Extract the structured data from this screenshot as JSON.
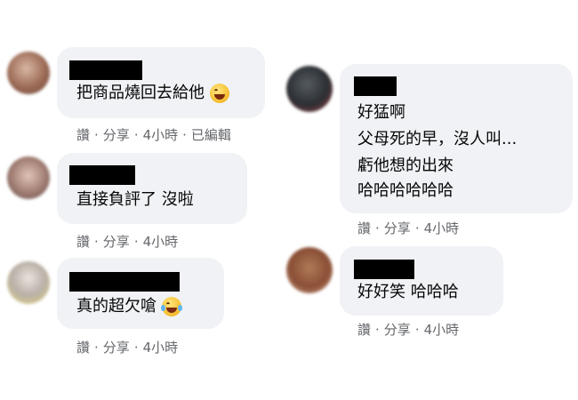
{
  "comments": [
    {
      "text_lines": [
        "把商品燒回去給他"
      ],
      "emoji": "grinning-squinting-tongue-emoji",
      "actions": {
        "reply": "讚",
        "share": "分享",
        "time": "4小時",
        "edited": "已編輯"
      }
    },
    {
      "text_lines": [
        "直接負評了 沒啦"
      ],
      "actions": {
        "reply": "讚",
        "share": "分享",
        "time": "4小時"
      }
    },
    {
      "text_lines": [
        "真的超欠嗆"
      ],
      "emoji": "face-with-tears-of-joy-emoji",
      "actions": {
        "reply": "讚",
        "share": "分享",
        "time": "4小時"
      }
    },
    {
      "text_lines": [
        "好猛啊",
        "父母死的早，沒人叫...",
        "虧他想的出來",
        "哈哈哈哈哈哈"
      ],
      "actions": {
        "reply": "讚",
        "share": "分享",
        "time": "4小時"
      }
    },
    {
      "text_lines": [
        "好好笑 哈哈哈"
      ],
      "actions": {
        "reply": "讚",
        "share": "分享",
        "time": "4小時"
      }
    }
  ],
  "colors": {
    "bubble": "#f0f2f5",
    "text": "#050505",
    "meta": "#65676b",
    "redaction": "#000000"
  }
}
